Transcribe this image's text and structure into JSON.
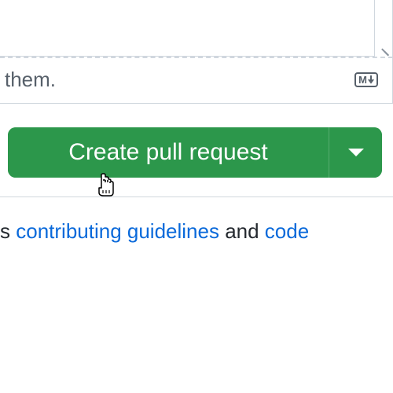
{
  "editor": {
    "footer_suffix": "them."
  },
  "button": {
    "create_label": "Create pull request"
  },
  "links": {
    "prefix": "s ",
    "contributing": "contributing guidelines",
    "connector": " and ",
    "code": "code"
  }
}
